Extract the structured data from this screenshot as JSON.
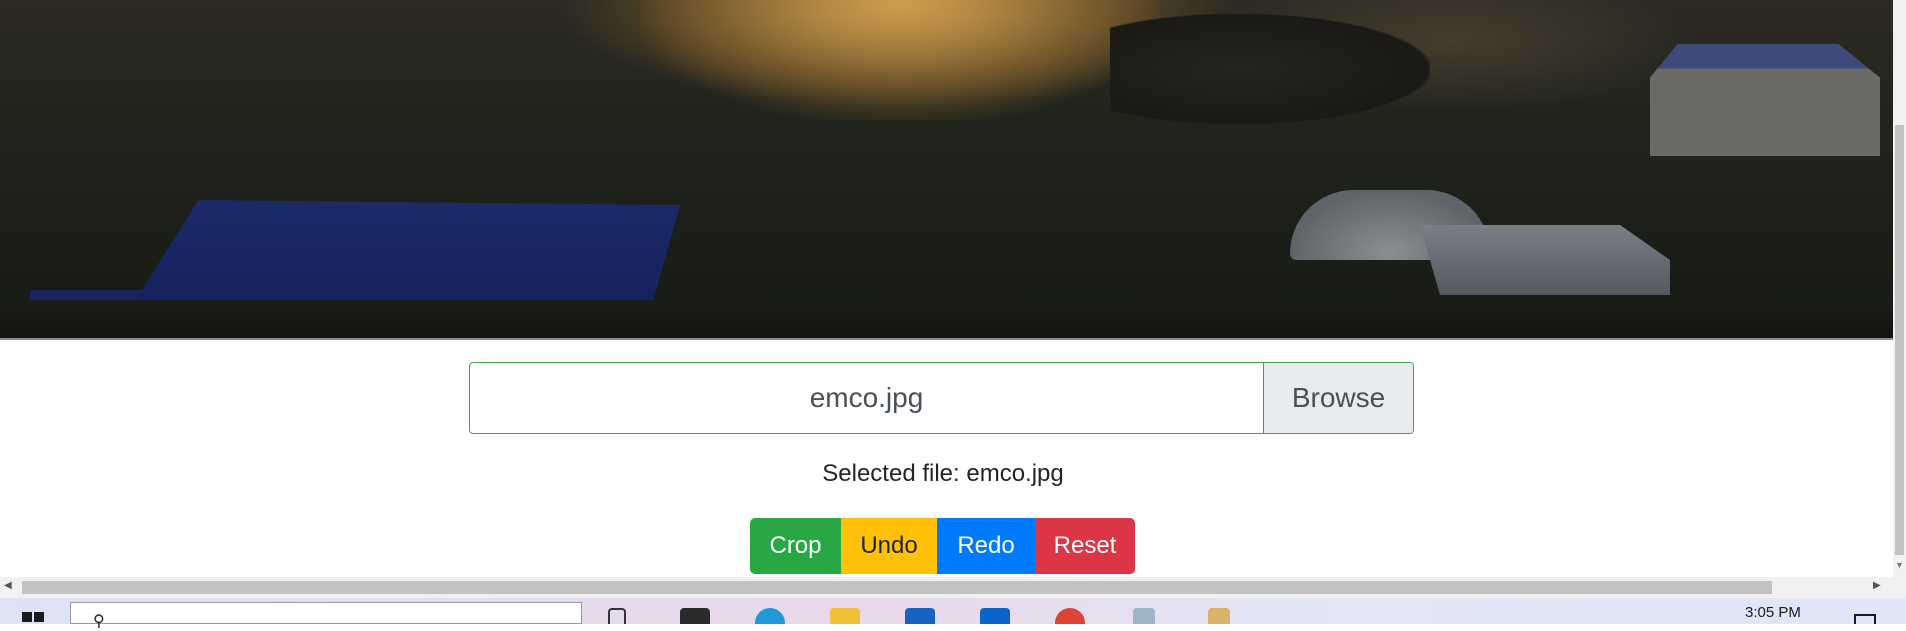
{
  "file_input": {
    "filename": "emco.jpg",
    "browse_label": "Browse"
  },
  "selected_file_text": "Selected file: emco.jpg",
  "buttons": {
    "crop": "Crop",
    "undo": "Undo",
    "redo": "Redo",
    "reset": "Reset"
  },
  "colors": {
    "crop": "#28a745",
    "undo": "#ffc107",
    "redo": "#007bff",
    "reset": "#dc3545",
    "input_border": "#3aa54a"
  },
  "taskbar": {
    "clock": "3:05 PM",
    "icons": [
      "windows-start-icon",
      "search-icon",
      "task-view-icon",
      "terminal-icon",
      "edge-icon",
      "file-explorer-icon",
      "mail-icon",
      "outlook-icon",
      "chrome-icon",
      "notepad-icon",
      "paint-icon",
      "notifications-icon"
    ]
  }
}
